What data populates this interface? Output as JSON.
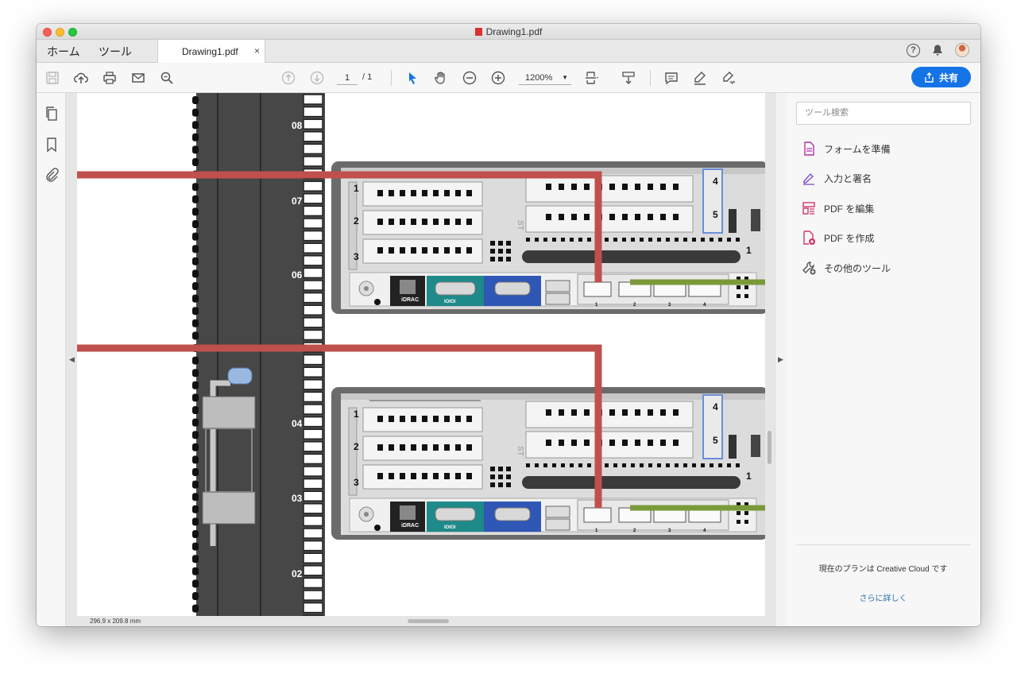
{
  "window": {
    "title": "Drawing1.pdf"
  },
  "tabs": {
    "home": "ホーム",
    "tools": "ツール",
    "document": "Drawing1.pdf",
    "close": "×"
  },
  "toolbar": {
    "page_current": "1",
    "page_total": "/ 1",
    "zoom": "1200%",
    "share_label": "共有"
  },
  "tools_panel": {
    "search_placeholder": "ツール検索",
    "items": [
      {
        "label": "フォームを準備",
        "icon": "prepare-form-icon",
        "color": "#b830a8"
      },
      {
        "label": "入力と署名",
        "icon": "fill-sign-icon",
        "color": "#7a4dc8"
      },
      {
        "label": "PDF を編集",
        "icon": "edit-pdf-icon",
        "color": "#d2366a"
      },
      {
        "label": "PDF を作成",
        "icon": "create-pdf-icon",
        "color": "#d2366a"
      },
      {
        "label": "その他のツール",
        "icon": "more-tools-icon",
        "color": "#555555"
      }
    ],
    "plan_text": "現在のプランは Creative Cloud です",
    "more_link": "さらに詳しく"
  },
  "document": {
    "page_size": "296.9 x 209.8 mm",
    "rack_units": [
      "08",
      "07",
      "06",
      "04",
      "03",
      "02"
    ],
    "server_labels": {
      "slots": [
        "1",
        "2",
        "3"
      ],
      "risers": [
        "4",
        "5"
      ],
      "psu": "1",
      "st": "ST",
      "idrac": "iDRAC",
      "serial": "IOIOI",
      "nic_ports": [
        "1",
        "2",
        "3",
        "4"
      ]
    }
  },
  "colors": {
    "accent": "#1473e6",
    "cable_red": "#c0504d",
    "cable_green": "#7a9a3a",
    "rack": "#484848"
  }
}
